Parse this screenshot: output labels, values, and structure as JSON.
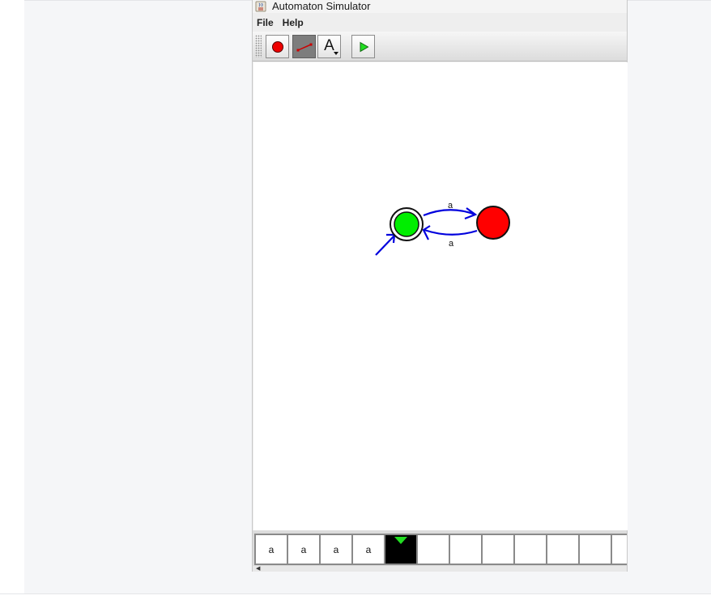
{
  "window": {
    "title": "Automaton Simulator"
  },
  "menu": {
    "items": [
      "File",
      "Help"
    ]
  },
  "toolbar": {
    "tools": [
      {
        "name": "add-state-tool",
        "icon": "red-circle-icon",
        "selected": false
      },
      {
        "name": "add-transition-tool",
        "icon": "edge-icon",
        "selected": true
      },
      {
        "name": "text-tool",
        "icon": "letter-a-icon",
        "label": "A",
        "selected": false
      },
      {
        "name": "run-tool",
        "icon": "play-icon",
        "selected": false
      }
    ]
  },
  "automaton": {
    "states": [
      {
        "id": "s0",
        "color": "#00ee00",
        "initial": true,
        "accepting": true
      },
      {
        "id": "s1",
        "color": "#ff0000",
        "initial": false,
        "accepting": false
      }
    ],
    "transitions": [
      {
        "from": "s0",
        "to": "s1",
        "label": "a"
      },
      {
        "from": "s1",
        "to": "s0",
        "label": "a"
      }
    ],
    "edge_color": "#0000dd"
  },
  "tape": {
    "cells": [
      "a",
      "a",
      "a",
      "a",
      "",
      "",
      "",
      "",
      "",
      "",
      "",
      ""
    ],
    "head_index": 4
  }
}
